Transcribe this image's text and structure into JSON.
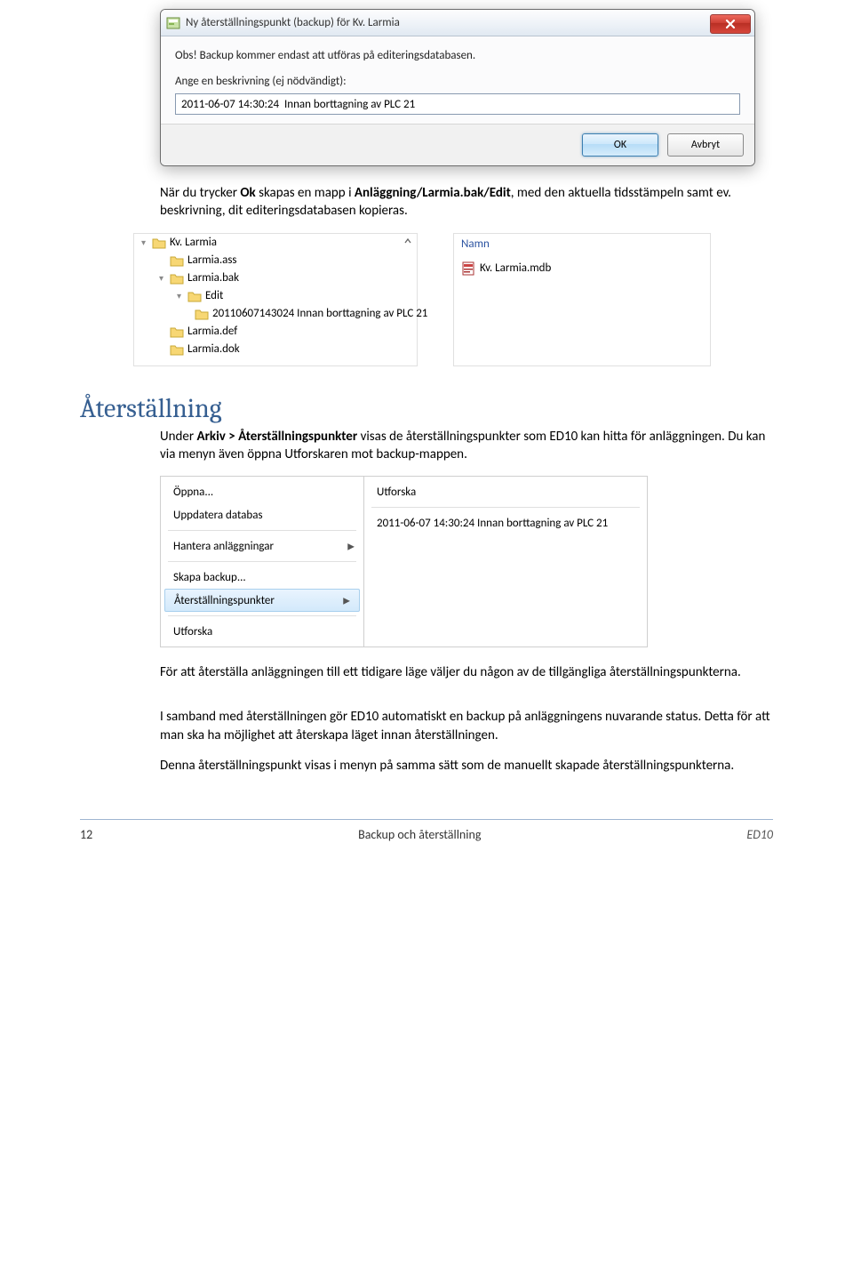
{
  "dialog": {
    "title": "Ny återställningspunkt (backup) för Kv. Larmia",
    "notice": "Obs! Backup kommer endast att utföras på editeringsdatabasen.",
    "prompt": "Ange en beskrivning (ej nödvändigt):",
    "input_value": "2011-06-07 14:30:24  Innan borttagning av PLC 21",
    "ok": "OK",
    "cancel": "Avbryt"
  },
  "para1": {
    "t0": "När du trycker ",
    "b0": "Ok",
    "t1": " skapas en mapp i ",
    "b1": "Anläggning/Larmia.bak/Edit",
    "t2": ", med den aktuella tidsstämpeln samt ev. beskrivning, dit editeringsdatabasen kopieras."
  },
  "tree": {
    "items": [
      {
        "name": "Kv. Larmia",
        "indent": 0,
        "twisty": "▾"
      },
      {
        "name": "Larmia.ass",
        "indent": 1,
        "twisty": ""
      },
      {
        "name": "Larmia.bak",
        "indent": 1,
        "twisty": "▾"
      },
      {
        "name": "Edit",
        "indent": 2,
        "twisty": "▾"
      },
      {
        "name": "20110607143024 Innan borttagning av PLC 21",
        "indent": 3,
        "twisty": ""
      },
      {
        "name": "Larmia.def",
        "indent": 1,
        "twisty": ""
      },
      {
        "name": "Larmia.dok",
        "indent": 1,
        "twisty": ""
      }
    ]
  },
  "filepanel": {
    "col": "Namn",
    "file": "Kv. Larmia.mdb"
  },
  "heading": "Återställning",
  "para2": {
    "t0": "Under ",
    "b0": "Arkiv > Återställningspunkter",
    "t1": " visas de återställningspunkter som ED10 kan hitta för anläggningen. Du kan via menyn även öppna Utforskaren mot backup-mappen."
  },
  "menu": {
    "left": {
      "open": "Öppna...",
      "update": "Uppdatera databas",
      "manage": "Hantera anläggningar",
      "create": "Skapa backup...",
      "restore": "Återställningspunkter",
      "explore": "Utforska"
    },
    "right": {
      "explore": "Utforska",
      "entry": "2011-06-07 14:30:24 Innan borttagning av PLC 21"
    }
  },
  "para3": "För att återställa anläggningen till ett tidigare läge väljer du någon av de tillgängliga återställningspunkterna.",
  "para4": "I samband med återställningen gör ED10 automatiskt en backup på anläggningens nuvarande status. Detta för att man ska ha möjlighet att återskapa läget innan återställningen.",
  "para5": "Denna återställningspunkt visas i menyn på samma sätt som de manuellt skapade återställningspunkterna.",
  "footer": {
    "page": "12",
    "title": "Backup och återställning",
    "doc": "ED10"
  }
}
